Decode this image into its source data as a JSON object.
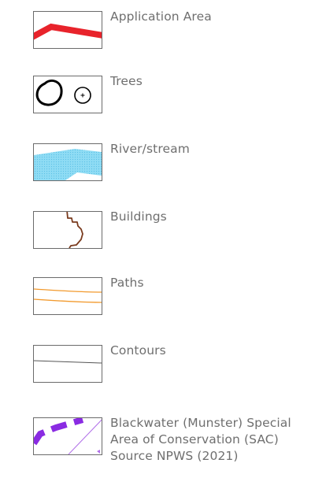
{
  "legend": {
    "items": [
      {
        "key": "application-area",
        "label": "Application Area",
        "color": "#e8232b"
      },
      {
        "key": "trees",
        "label": "Trees",
        "color": "#000000"
      },
      {
        "key": "river-stream",
        "label": "River/stream",
        "color": "#7fd3f0"
      },
      {
        "key": "buildings",
        "label": "Buildings",
        "color": "#7a3b1e"
      },
      {
        "key": "paths",
        "label": "Paths",
        "color": "#f29a2e"
      },
      {
        "key": "contours",
        "label": "Contours",
        "color": "#555555"
      },
      {
        "key": "sac",
        "label_lines": [
          "Blackwater (Munster) Special",
          "Area of Conservation (SAC)",
          "Source NPWS (2021)"
        ],
        "color": "#8a2be2"
      }
    ]
  }
}
